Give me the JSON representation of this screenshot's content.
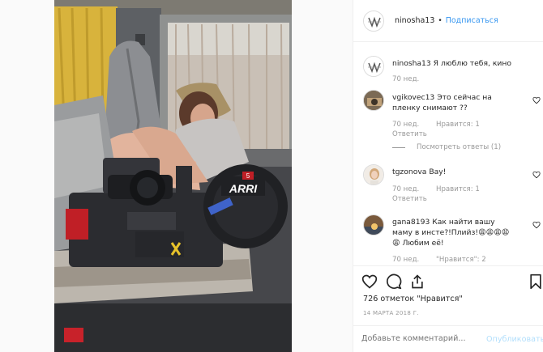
{
  "post": {
    "username": "ninosha13",
    "separator": "•",
    "follow_label": "Подписаться"
  },
  "caption": {
    "username": "ninosha13",
    "text": "Я люблю тебя, кино",
    "time": "70 нед."
  },
  "comments": [
    {
      "username": "vgikovec13",
      "text": "Это сейчас на пленку снимают ??",
      "time": "70 нед.",
      "likes": "Нравится: 1",
      "reply": "Ответить",
      "view_replies": "Посмотреть ответы (1)"
    },
    {
      "username": "tgzonova",
      "text": "Вау!",
      "time": "70 нед.",
      "likes": "Нравится: 1",
      "reply": "Ответить"
    },
    {
      "username": "gana8193",
      "text": "Как найти вашу маму в инсте?!Плийз!😩😩😩😩😩 Любим её!",
      "time": "70 нед.",
      "likes": "\"Нравится\": 2"
    }
  ],
  "likes_text": "726 отметок \"Нравится\"",
  "date_text": "14 МАРТА 2018 Г.",
  "add_comment_placeholder": "Добавьте комментарий...",
  "publish_label": "Опубликовать",
  "photo_text": {
    "brand": "ARRI",
    "number": "5"
  },
  "colors": {
    "link_blue": "#3897f0",
    "muted": "#999999",
    "border": "#efefef",
    "publish_disabled": "#b2dffc"
  }
}
